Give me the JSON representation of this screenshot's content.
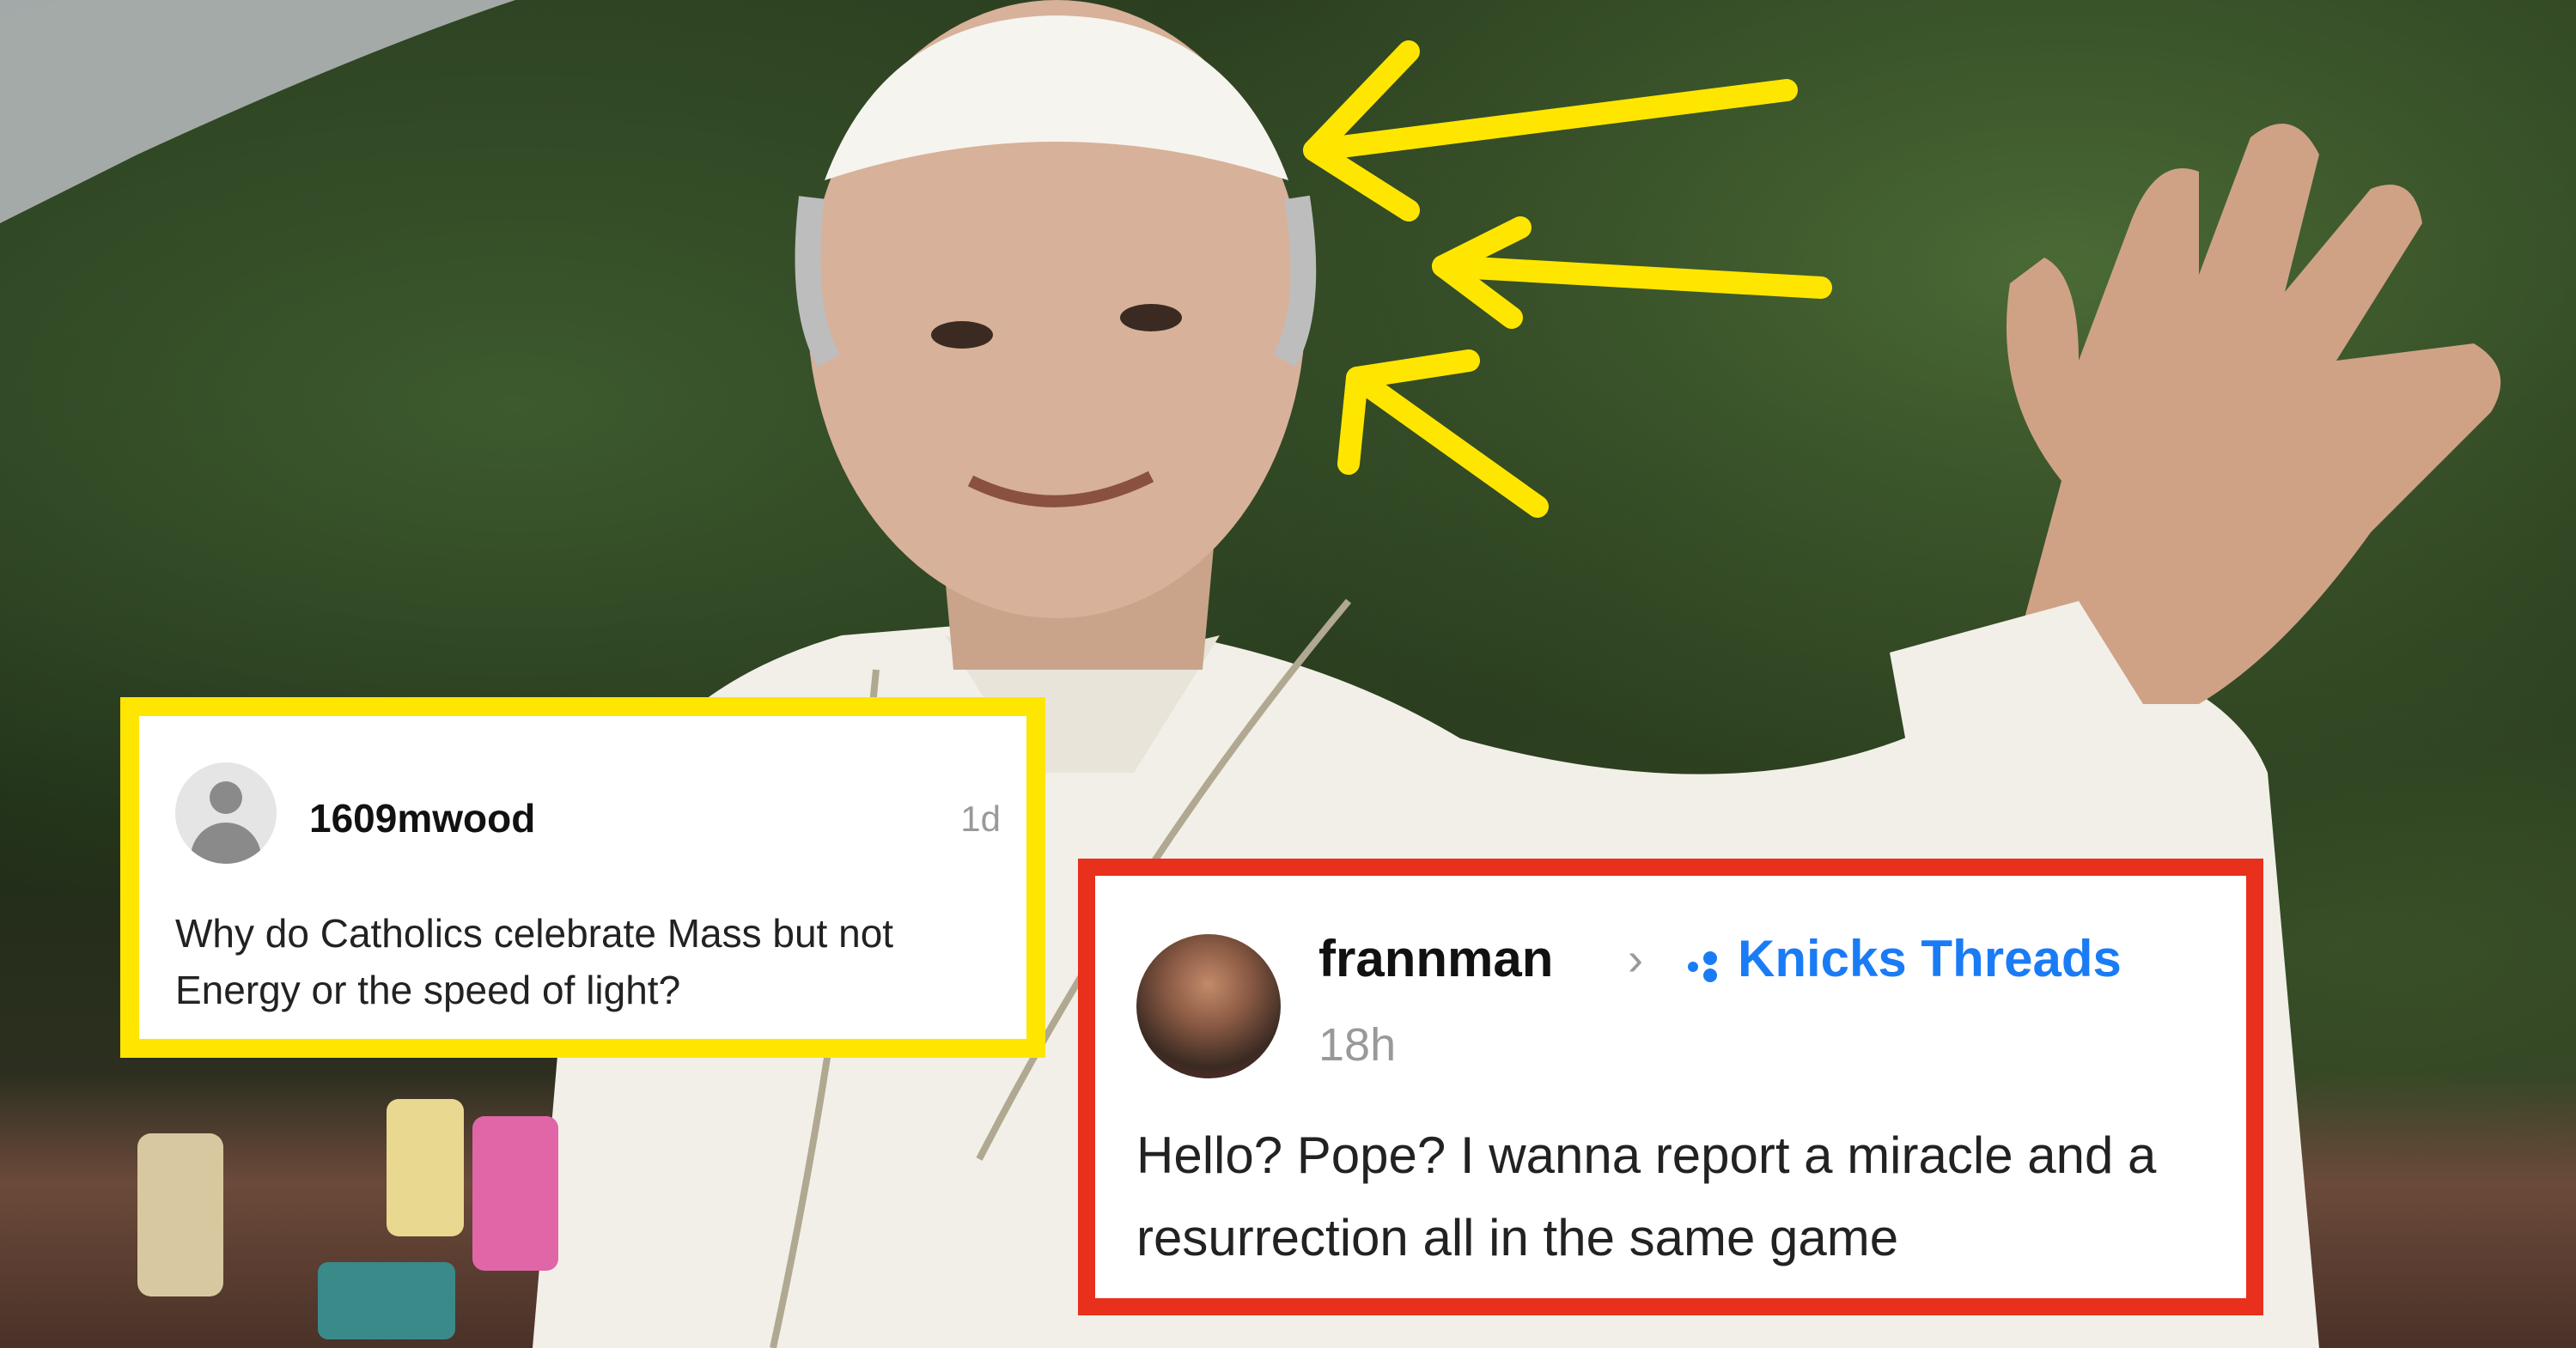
{
  "post_left": {
    "username": "1609mwood",
    "time": "1d",
    "text": "Why do Catholics celebrate Mass but not Energy or the speed of light?",
    "border_color": "#ffe600"
  },
  "post_right": {
    "username": "frannman",
    "community": "Knicks Threads",
    "time": "18h",
    "text": "Hello? Pope? I wanna report a miracle and a resurrection all in the same game",
    "border_color": "#e8301c",
    "accent": "#1a7cf5"
  },
  "arrows": {
    "count": 3,
    "color": "#ffe600"
  }
}
